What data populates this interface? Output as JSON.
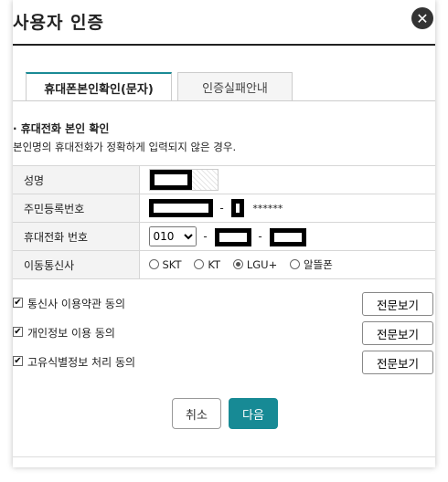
{
  "dialog": {
    "title": "사용자 인증",
    "close": "✕"
  },
  "tabs": {
    "active": "휴대폰본인확인(문자)",
    "inactive": "인증실패안내"
  },
  "section": {
    "title": "· 휴대전화 본인 확인",
    "desc": "본인명의 휴대전화가 정확하게 입력되지 않은 경우."
  },
  "form": {
    "name_label": "성명",
    "rrn_label": "주민등록번호",
    "rrn_dash": "-",
    "rrn_mask": "******",
    "phone_label": "휴대전화 번호",
    "phone_prefix": "010",
    "phone_dash1": "-",
    "phone_dash2": "-",
    "carrier_label": "이동통신사",
    "carriers": [
      {
        "label": "SKT",
        "selected": false
      },
      {
        "label": "KT",
        "selected": false
      },
      {
        "label": "LGU+",
        "selected": true
      },
      {
        "label": "알뜰폰",
        "selected": false
      }
    ]
  },
  "agreements": [
    {
      "label": "통신사 이용약관 동의",
      "checked": true,
      "button": "전문보기"
    },
    {
      "label": "개인정보 이용 동의",
      "checked": true,
      "button": "전문보기"
    },
    {
      "label": "고유식별정보 처리 동의",
      "checked": true,
      "button": "전문보기"
    }
  ],
  "actions": {
    "cancel": "취소",
    "next": "다음"
  },
  "colors": {
    "accent": "#178a95"
  }
}
